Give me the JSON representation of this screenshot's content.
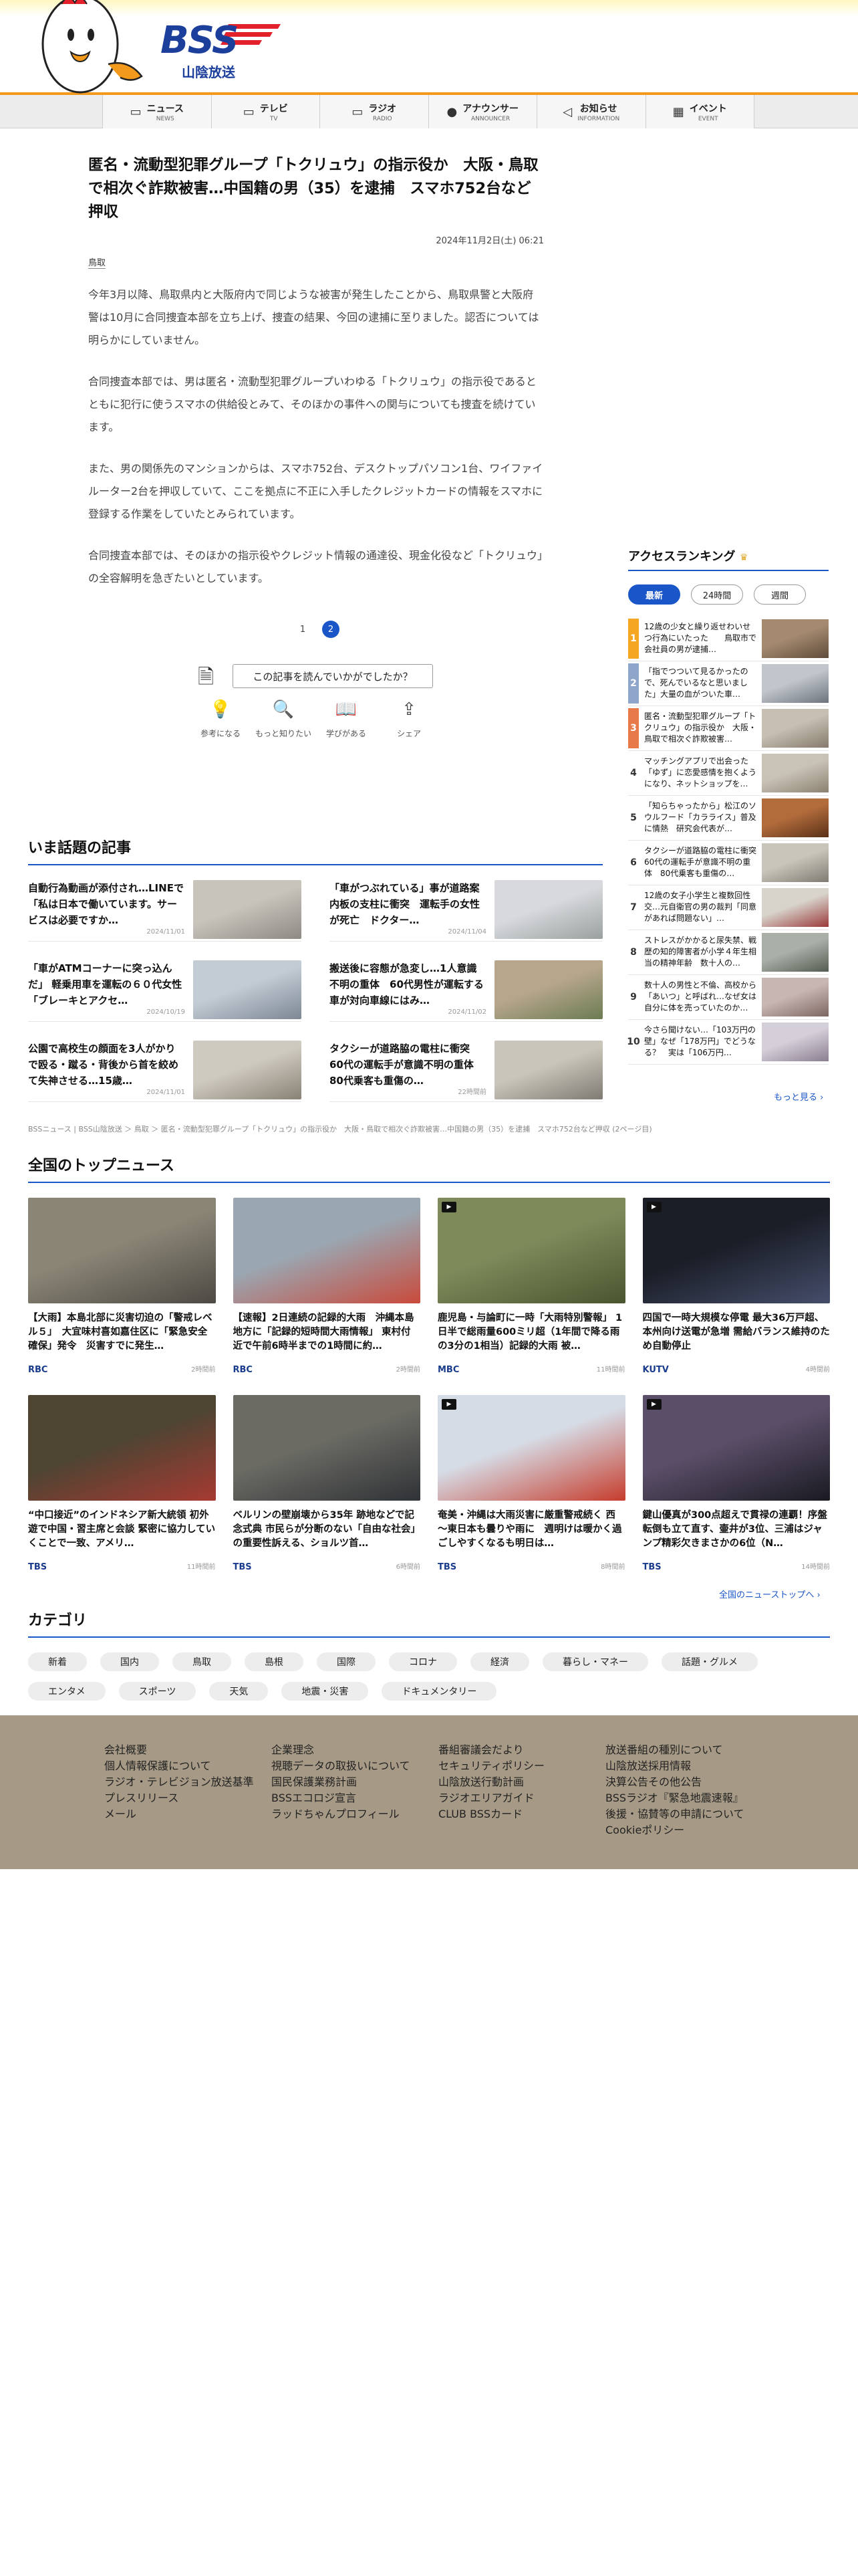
{
  "header": {
    "logo_text": "BSS",
    "logo_sub": "山陰放送"
  },
  "nav": [
    {
      "jp": "ニュース",
      "en": "NEWS",
      "icon": "news-icon",
      "glyph": "▭"
    },
    {
      "jp": "テレビ",
      "en": "TV",
      "icon": "tv-icon",
      "glyph": "▭"
    },
    {
      "jp": "ラジオ",
      "en": "RADIO",
      "icon": "radio-icon",
      "glyph": "▭"
    },
    {
      "jp": "アナウンサー",
      "en": "ANNOUNCER",
      "icon": "microphone-icon",
      "glyph": "●"
    },
    {
      "jp": "お知らせ",
      "en": "INFORMATION",
      "icon": "megaphone-icon",
      "glyph": "◁"
    },
    {
      "jp": "イベント",
      "en": "EVENT",
      "icon": "calendar-icon",
      "glyph": "▦"
    }
  ],
  "article": {
    "title": "匿名・流動型犯罪グループ「トクリュウ」の指示役か　大阪・鳥取で相次ぐ詐欺被害…中国籍の男（35）を逮捕　スマホ752台など押収",
    "date": "2024年11月2日(土) 06:21",
    "tag": "鳥取",
    "paragraphs": [
      "今年3月以降、鳥取県内と大阪府内で同じような被害が発生したことから、鳥取県警と大阪府警は10月に合同捜査本部を立ち上げ、捜査の結果、今回の逮捕に至りました。認否については明らかにしていません。",
      "合同捜査本部では、男は匿名・流動型犯罪グループいわゆる「トクリュウ」の指示役であるとともに犯行に使うスマホの供給役とみて、そのほかの事件への関与についても捜査を続けています。",
      "また、男の関係先のマンションからは、スマホ752台、デスクトップパソコン1台、ワイファイルーター2台を押収していて、ここを拠点に不正に入手したクレジットカードの情報をスマホに登録する作業をしていたとみられています。",
      "合同捜査本部では、そのほかの指示役やクレジット情報の通達役、現金化役など「トクリュウ」の全容解明を急ぎたいとしています。"
    ],
    "pages": [
      "1",
      "2"
    ]
  },
  "feedback": {
    "question": "この記事を読んでいかがでしたか？",
    "options": [
      {
        "label": "参考になる",
        "icon": "lightbulb-icon",
        "glyph": "💡"
      },
      {
        "label": "もっと知りたい",
        "icon": "magnifier-icon",
        "glyph": "🔍"
      },
      {
        "label": "学びがある",
        "icon": "book-icon",
        "glyph": "📖"
      },
      {
        "label": "シェア",
        "icon": "share-icon",
        "glyph": "⇪"
      }
    ]
  },
  "hot": {
    "heading": "いま話題の記事",
    "items": [
      {
        "title": "自動行為動画が添付され…LINEで「私は日本で働いています。サービスは必要ですか…",
        "date": "2024/11/01",
        "c1": "#c8c4bc",
        "c2": "#8d8a84"
      },
      {
        "title": "「車がつぶれている」事が道路案内板の支柱に衝突　運転手の女性が死亡　ドクター…",
        "date": "2024/11/04",
        "c1": "#d7d9dc",
        "c2": "#9aa09f"
      },
      {
        "title": "「車がATMコーナーに突っ込んだ」 軽乗用車を運転の６０代女性「ブレーキとアクセ…",
        "date": "2024/10/19",
        "c1": "#c3cbd4",
        "c2": "#7d8894"
      },
      {
        "title": "搬送後に容態が急変し…1人意識不明の重体　60代男性が運転する車が対向車線にはみ…",
        "date": "2024/11/02",
        "c1": "#b7a68c",
        "c2": "#6b7c52"
      },
      {
        "title": "公園で高校生の顔面を3人がかりで殴る・蹴る・背後から首を絞めて失神させる…15歳…",
        "date": "2024/11/01",
        "c1": "#cfcabf",
        "c2": "#888276"
      },
      {
        "title": "タクシーが道路脇の電柱に衝突　60代の運転手が意識不明の重体　80代乗客も重傷の…",
        "date": "22時間前",
        "c1": "#c9c5ba",
        "c2": "#7f7b73"
      }
    ]
  },
  "ranking": {
    "heading": "アクセスランキング",
    "tabs": [
      "最新",
      "24時間",
      "週間"
    ],
    "items": [
      {
        "n": "1",
        "title": "12歳の少女と繰り返せわいせつ行為にいたった　　鳥取市で会社員の男が逮捕…",
        "c1": "#a58a70",
        "c2": "#5f4c3a"
      },
      {
        "n": "2",
        "title": "「指でつついて見るかったので、死んでいるなと思いました」大量の血がついた車…",
        "c1": "#c1c6cc",
        "c2": "#6d747c"
      },
      {
        "n": "3",
        "title": "匿名・流動型犯罪グループ「トクリュウ」の指示役か　大阪・鳥取で相次ぐ詐欺被害…",
        "c1": "#c6bfb2",
        "c2": "#857b6c"
      },
      {
        "n": "4",
        "title": "マッチングアプリで出会った「ゆず」に恋愛感情を抱くようになり、ネットショップを…",
        "c1": "#c9c3b6",
        "c2": "#8b8171"
      },
      {
        "n": "5",
        "title": "「知らちゃったから」松江のソウルフード「カラライス」普及に情熱　研究会代表が…",
        "c1": "#b26c3c",
        "c2": "#5a3017"
      },
      {
        "n": "6",
        "title": "タクシーが道路脇の電柱に衝突　60代の運転手が意識不明の重体　80代乗客も重傷の…",
        "c1": "#c9c5ba",
        "c2": "#7f7b73"
      },
      {
        "n": "7",
        "title": "12歳の女子小学生と複数回性交…元自衛官の男の裁判「同意があれば問題ない」…",
        "c1": "#d8d4cc",
        "c2": "#9a3a3a"
      },
      {
        "n": "8",
        "title": "ストレスがかかると尿失禁、戦歴の知的障害者が小学４年生相当の精神年齢　数十人の…",
        "c1": "#aab0a8",
        "c2": "#545c52"
      },
      {
        "n": "9",
        "title": "数十人の男性と不倫、高校から「あいつ」と呼ばれ…なぜ女は自分に体を売っていたのか…",
        "c1": "#c8b6b2",
        "c2": "#7d6662"
      },
      {
        "n": "10",
        "title": "今さら聞けない…「103万円の壁」なぜ「178万円」でどうなる？　実は「106万円…",
        "c1": "#d5cfd9",
        "c2": "#8a7e90"
      }
    ],
    "more": "もっと見る"
  },
  "breadcrumb": "BSSニュース | BSS山陰放送 ＞ 鳥取 ＞ 匿名・流動型犯罪グループ「トクリュウ」の指示役か　大阪・鳥取で相次ぐ詐欺被害…中国籍の男（35）を逮捕　スマホ752台など押収 (2ページ目)",
  "top": {
    "heading": "全国のトップニュース",
    "items": [
      {
        "title": "【大雨】本島北部に災害切迫の「警戒レベル５」　大宜味村喜如嘉住区に「緊急安全確保」発令　災害すでに発生…",
        "src": "RBC",
        "ago": "2時間前",
        "c1": "#8b8576",
        "c2": "#4c4a44",
        "video": false
      },
      {
        "title": "【速報】2日連続の記録的大雨　沖縄本島地方に「記録的短時間大雨情報」 東村付近で午前6時半までの1時間に約…",
        "src": "RBC",
        "ago": "2時間前",
        "c1": "#9aa7b2",
        "c2": "#c94a3b",
        "video": false
      },
      {
        "title": "鹿児島・与論町に一時「大雨特別警報」 1日半で総雨量600ミリ超（1年間で降る雨の3分の1相当）記録的大雨 被…",
        "src": "MBC",
        "ago": "11時間前",
        "c1": "#7e8a5a",
        "c2": "#4a5530",
        "video": true
      },
      {
        "title": "四国で一時大規模な停電 最大36万戸超、本州向け送電が急増 需給バランス維持のため自動停止",
        "src": "KUTV",
        "ago": "4時間前",
        "c1": "#1b1e27",
        "c2": "#454d6a",
        "video": true
      },
      {
        "title": "“中口接近”のインドネシア新大統領 初外遊で中国・習主席と会談 緊密に協力していくことで一致、アメリ…",
        "src": "TBS",
        "ago": "11時間前",
        "c1": "#4d4432",
        "c2": "#a63a32",
        "video": false
      },
      {
        "title": "ベルリンの壁崩壊から35年 跡地などで記念式典 市民らが分断のない「自由な社会」の重要性訴える、ショルツ首…",
        "src": "TBS",
        "ago": "6時間前",
        "c1": "#6b6b64",
        "c2": "#2f3236",
        "video": false
      },
      {
        "title": "奄美・沖縄は大雨災害に厳重警戒続く 西～東日本も曇りや雨に　週明けは暖かく過ごしやすくなるも明日は…",
        "src": "TBS",
        "ago": "8時間前",
        "c1": "#d6dce6",
        "c2": "#c63c2c",
        "video": true
      },
      {
        "title": "鍵山優真が300点超えで貫禄の連覇！序盤転倒も立て直す、壷井が3位、三浦はジャンプ精彩欠きまさかの6位（N…",
        "src": "TBS",
        "ago": "14時間前",
        "c1": "#5a4e68",
        "c2": "#1a1a22",
        "video": true
      }
    ],
    "more": "全国のニューストップへ"
  },
  "categories": {
    "heading": "カテゴリ",
    "items": [
      "新着",
      "国内",
      "鳥取",
      "島根",
      "国際",
      "コロナ",
      "経済",
      "暮らし・マネー",
      "話題・グルメ",
      "エンタメ",
      "スポーツ",
      "天気",
      "地震・災害",
      "ドキュメンタリー"
    ]
  },
  "footer": {
    "cols": [
      [
        "会社概要",
        "個人情報保護について",
        "ラジオ・テレビジョン放送基準",
        "プレスリリース",
        "メール"
      ],
      [
        "企業理念",
        "視聴データの取扱いについて",
        "国民保護業務計画",
        "BSSエコロジ宣言",
        "ラッドちゃんプロフィール"
      ],
      [
        "番組審議会だより",
        "セキュリティポリシー",
        "山陰放送行動計画",
        "ラジオエリアガイド",
        "CLUB BSSカード"
      ],
      [
        "放送番組の種別について",
        "山陰放送採用情報",
        "決算公告その他公告",
        "BSSラジオ『緊急地震速報』",
        "後援・協賛等の申請について",
        "Cookieポリシー"
      ]
    ]
  },
  "colors": {
    "accent": "#1a56c8",
    "brand_orange": "#f39a1c",
    "brand_navy": "#1d3f9c",
    "brand_red": "#e3212a",
    "footer_bg": "#a69a86"
  }
}
